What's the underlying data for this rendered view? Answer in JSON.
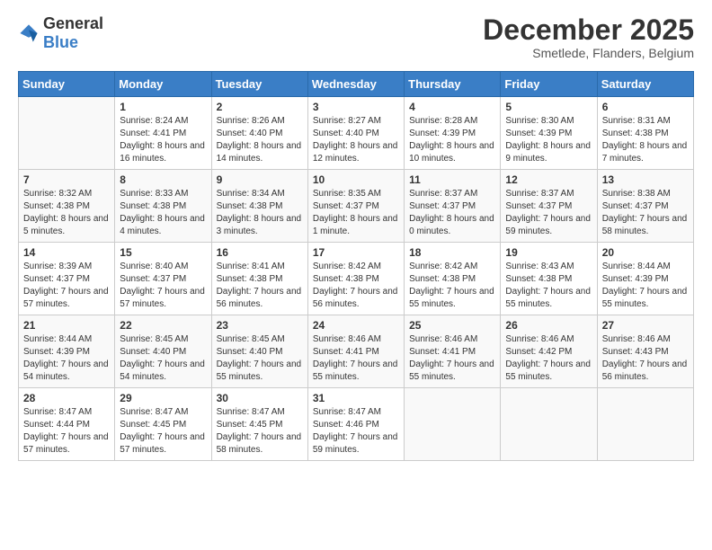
{
  "logo": {
    "general": "General",
    "blue": "Blue"
  },
  "header": {
    "month": "December 2025",
    "location": "Smetlede, Flanders, Belgium"
  },
  "weekdays": [
    "Sunday",
    "Monday",
    "Tuesday",
    "Wednesday",
    "Thursday",
    "Friday",
    "Saturday"
  ],
  "weeks": [
    [
      {
        "day": "",
        "sunrise": "",
        "sunset": "",
        "daylight": ""
      },
      {
        "day": "1",
        "sunrise": "Sunrise: 8:24 AM",
        "sunset": "Sunset: 4:41 PM",
        "daylight": "Daylight: 8 hours and 16 minutes."
      },
      {
        "day": "2",
        "sunrise": "Sunrise: 8:26 AM",
        "sunset": "Sunset: 4:40 PM",
        "daylight": "Daylight: 8 hours and 14 minutes."
      },
      {
        "day": "3",
        "sunrise": "Sunrise: 8:27 AM",
        "sunset": "Sunset: 4:40 PM",
        "daylight": "Daylight: 8 hours and 12 minutes."
      },
      {
        "day": "4",
        "sunrise": "Sunrise: 8:28 AM",
        "sunset": "Sunset: 4:39 PM",
        "daylight": "Daylight: 8 hours and 10 minutes."
      },
      {
        "day": "5",
        "sunrise": "Sunrise: 8:30 AM",
        "sunset": "Sunset: 4:39 PM",
        "daylight": "Daylight: 8 hours and 9 minutes."
      },
      {
        "day": "6",
        "sunrise": "Sunrise: 8:31 AM",
        "sunset": "Sunset: 4:38 PM",
        "daylight": "Daylight: 8 hours and 7 minutes."
      }
    ],
    [
      {
        "day": "7",
        "sunrise": "Sunrise: 8:32 AM",
        "sunset": "Sunset: 4:38 PM",
        "daylight": "Daylight: 8 hours and 5 minutes."
      },
      {
        "day": "8",
        "sunrise": "Sunrise: 8:33 AM",
        "sunset": "Sunset: 4:38 PM",
        "daylight": "Daylight: 8 hours and 4 minutes."
      },
      {
        "day": "9",
        "sunrise": "Sunrise: 8:34 AM",
        "sunset": "Sunset: 4:38 PM",
        "daylight": "Daylight: 8 hours and 3 minutes."
      },
      {
        "day": "10",
        "sunrise": "Sunrise: 8:35 AM",
        "sunset": "Sunset: 4:37 PM",
        "daylight": "Daylight: 8 hours and 1 minute."
      },
      {
        "day": "11",
        "sunrise": "Sunrise: 8:37 AM",
        "sunset": "Sunset: 4:37 PM",
        "daylight": "Daylight: 8 hours and 0 minutes."
      },
      {
        "day": "12",
        "sunrise": "Sunrise: 8:37 AM",
        "sunset": "Sunset: 4:37 PM",
        "daylight": "Daylight: 7 hours and 59 minutes."
      },
      {
        "day": "13",
        "sunrise": "Sunrise: 8:38 AM",
        "sunset": "Sunset: 4:37 PM",
        "daylight": "Daylight: 7 hours and 58 minutes."
      }
    ],
    [
      {
        "day": "14",
        "sunrise": "Sunrise: 8:39 AM",
        "sunset": "Sunset: 4:37 PM",
        "daylight": "Daylight: 7 hours and 57 minutes."
      },
      {
        "day": "15",
        "sunrise": "Sunrise: 8:40 AM",
        "sunset": "Sunset: 4:37 PM",
        "daylight": "Daylight: 7 hours and 57 minutes."
      },
      {
        "day": "16",
        "sunrise": "Sunrise: 8:41 AM",
        "sunset": "Sunset: 4:38 PM",
        "daylight": "Daylight: 7 hours and 56 minutes."
      },
      {
        "day": "17",
        "sunrise": "Sunrise: 8:42 AM",
        "sunset": "Sunset: 4:38 PM",
        "daylight": "Daylight: 7 hours and 56 minutes."
      },
      {
        "day": "18",
        "sunrise": "Sunrise: 8:42 AM",
        "sunset": "Sunset: 4:38 PM",
        "daylight": "Daylight: 7 hours and 55 minutes."
      },
      {
        "day": "19",
        "sunrise": "Sunrise: 8:43 AM",
        "sunset": "Sunset: 4:38 PM",
        "daylight": "Daylight: 7 hours and 55 minutes."
      },
      {
        "day": "20",
        "sunrise": "Sunrise: 8:44 AM",
        "sunset": "Sunset: 4:39 PM",
        "daylight": "Daylight: 7 hours and 55 minutes."
      }
    ],
    [
      {
        "day": "21",
        "sunrise": "Sunrise: 8:44 AM",
        "sunset": "Sunset: 4:39 PM",
        "daylight": "Daylight: 7 hours and 54 minutes."
      },
      {
        "day": "22",
        "sunrise": "Sunrise: 8:45 AM",
        "sunset": "Sunset: 4:40 PM",
        "daylight": "Daylight: 7 hours and 54 minutes."
      },
      {
        "day": "23",
        "sunrise": "Sunrise: 8:45 AM",
        "sunset": "Sunset: 4:40 PM",
        "daylight": "Daylight: 7 hours and 55 minutes."
      },
      {
        "day": "24",
        "sunrise": "Sunrise: 8:46 AM",
        "sunset": "Sunset: 4:41 PM",
        "daylight": "Daylight: 7 hours and 55 minutes."
      },
      {
        "day": "25",
        "sunrise": "Sunrise: 8:46 AM",
        "sunset": "Sunset: 4:41 PM",
        "daylight": "Daylight: 7 hours and 55 minutes."
      },
      {
        "day": "26",
        "sunrise": "Sunrise: 8:46 AM",
        "sunset": "Sunset: 4:42 PM",
        "daylight": "Daylight: 7 hours and 55 minutes."
      },
      {
        "day": "27",
        "sunrise": "Sunrise: 8:46 AM",
        "sunset": "Sunset: 4:43 PM",
        "daylight": "Daylight: 7 hours and 56 minutes."
      }
    ],
    [
      {
        "day": "28",
        "sunrise": "Sunrise: 8:47 AM",
        "sunset": "Sunset: 4:44 PM",
        "daylight": "Daylight: 7 hours and 57 minutes."
      },
      {
        "day": "29",
        "sunrise": "Sunrise: 8:47 AM",
        "sunset": "Sunset: 4:45 PM",
        "daylight": "Daylight: 7 hours and 57 minutes."
      },
      {
        "day": "30",
        "sunrise": "Sunrise: 8:47 AM",
        "sunset": "Sunset: 4:45 PM",
        "daylight": "Daylight: 7 hours and 58 minutes."
      },
      {
        "day": "31",
        "sunrise": "Sunrise: 8:47 AM",
        "sunset": "Sunset: 4:46 PM",
        "daylight": "Daylight: 7 hours and 59 minutes."
      },
      {
        "day": "",
        "sunrise": "",
        "sunset": "",
        "daylight": ""
      },
      {
        "day": "",
        "sunrise": "",
        "sunset": "",
        "daylight": ""
      },
      {
        "day": "",
        "sunrise": "",
        "sunset": "",
        "daylight": ""
      }
    ]
  ]
}
